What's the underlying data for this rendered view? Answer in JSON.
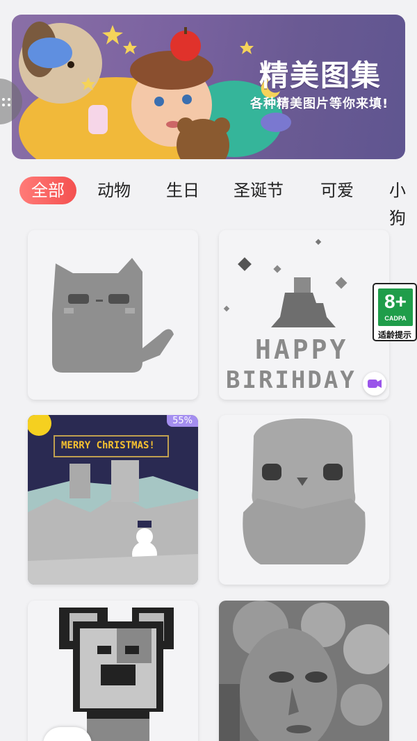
{
  "banner": {
    "title": "精美图集",
    "subtitle": "各种精美图片等你来填!"
  },
  "tabs": [
    {
      "label": "全部",
      "active": true
    },
    {
      "label": "动物",
      "active": false
    },
    {
      "label": "生日",
      "active": false
    },
    {
      "label": "圣诞节",
      "active": false
    },
    {
      "label": "可爱",
      "active": false
    },
    {
      "label": "小狗",
      "active": false
    }
  ],
  "cards": [
    {
      "name": "cat",
      "progress": null,
      "video": false
    },
    {
      "name": "birthday",
      "progress": null,
      "video": true,
      "text_line1": "HAPPY",
      "text_line2": "BIRIHDAY"
    },
    {
      "name": "christmas",
      "progress": "55%",
      "video": false,
      "sign": "MERRY ChRISTMAS!"
    },
    {
      "name": "chick",
      "progress": null,
      "video": false
    },
    {
      "name": "dog",
      "progress": null,
      "video": false
    },
    {
      "name": "woman-portrait",
      "progress": null,
      "video": false
    }
  ],
  "age_rating": {
    "number": "8+",
    "org": "CADPA",
    "label": "适龄提示"
  },
  "colors": {
    "accent": "#f4504f",
    "progress_badge": "#a48ef0",
    "rating_green": "#1f9d4a"
  }
}
